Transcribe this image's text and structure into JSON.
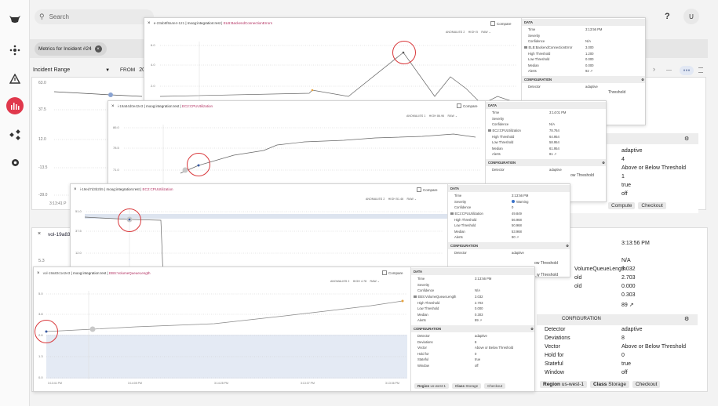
{
  "app": {
    "search_placeholder": "Search",
    "help": "?",
    "avatar": "U"
  },
  "sidebar": {
    "icons": [
      "cow-logo-icon",
      "hub-icon",
      "alert-triangle-icon",
      "analytics-icon",
      "workflow-icon",
      "gear-icon"
    ]
  },
  "chip": {
    "label": "Metrics for Incident #24"
  },
  "range": {
    "label": "Incident Range",
    "from_label": "FROM",
    "from_value": "2020,"
  },
  "rt": {
    "next": "›",
    "dashes": "—",
    "pill": "●●●"
  },
  "bgleft": {
    "yticks": [
      "37.5",
      "12.0",
      "-13.5",
      "-39.0"
    ],
    "ytop": "63.0",
    "xtime": "3:13:41 P",
    "label_5": "5.3"
  },
  "bgcard_a": {
    "detector": "adaptive",
    "deviations": "4",
    "vector": "Above or Below Threshold",
    "hold_for": "1",
    "stateful": "true",
    "window": "off",
    "btn_compute": "Compute",
    "btn_checkout": "Checkout"
  },
  "bgcard_b": {
    "title": "vol-19a83",
    "x": "×",
    "time": "3:13:56 PM",
    "confidence": "N/A",
    "metric_name": "VolumeQueueLength",
    "metric": "3.032",
    "high": "2.703",
    "low": "0.000",
    "median": "0.303",
    "alerts": "89 ↗",
    "alerts_link": "↗",
    "config": "CONFIGURATION",
    "detector_k": "Detector",
    "detector": "adaptive",
    "deviations_k": "Deviations",
    "deviations": "8",
    "vector_k": "Vector",
    "vector": "Above or Below Threshold",
    "hold_k": "Hold for",
    "hold": "0",
    "stateful_k": "Stateful",
    "stateful": "true",
    "window_k": "Window",
    "window": "off",
    "region": "Region",
    "region_v": "us-west-1",
    "class": "Class",
    "class_v": "Storage",
    "checkout": "Checkout",
    "hold_frag": "old",
    "old_frag": "old"
  },
  "p1": {
    "title": "e-23ab8f8a4e4-121",
    "src": "moog:integration:rest",
    "metric": "ELB:BackendConnectionErrors",
    "compare": "Compare",
    "anomalies": "ANOMALIES 2",
    "high": "HIGH 5",
    "raw": "RAW",
    "yticks": [
      "6.0",
      "4.0",
      "2.0"
    ],
    "data": {
      "Time": "3:13:56 PM",
      "Severity": "",
      "Confidence": "N/A",
      "ELB:BackendConnectionError": "3.000",
      "High Threshold": "1.200",
      "Low Threshold": "0.000",
      "Median": "0.000",
      "Alerts": "92 ↗"
    },
    "detector": "adaptive",
    "t_ov": "Threshold"
  },
  "p2": {
    "title": "i-19a84d0e42e3",
    "src": "moog:integration:rest",
    "metric": "EC2:CPUUtilization",
    "compare": "Compare",
    "anomalies": "ANOMALIES 1",
    "high": "HIGH 86.96",
    "raw": "RAW",
    "yticks": [
      "86.0",
      "78.5",
      "71.0"
    ],
    "data": {
      "Time": "3:14:01 PM",
      "Severity": "",
      "Confidence": "N/A",
      "EC2:CPUUtilization": "78.764",
      "High Threshold": "64.954",
      "Low Threshold": "58.954",
      "Median": "61.954",
      "Alerts": "81 ↗"
    },
    "detector": "adaptive",
    "t_ov": "ow Threshold",
    "ut": "ut"
  },
  "p3": {
    "title": "i-19ed7d3b2b5",
    "src": "moog:integration:rest",
    "metric": "EC2:CPUUtilization",
    "compare": "Compare",
    "anomalies": "ANOMALIES 2",
    "high": "HIGH 51.46",
    "raw": "RAW",
    "yticks": [
      "51.0",
      "37.5",
      "12.0"
    ],
    "data": {
      "Time": "3:13:56 PM",
      "Severity": "Warning",
      "Confidence": "0",
      "EC2:CPUUtilization": "49.849",
      "High Threshold": "56.968",
      "Low Threshold": "50.968",
      "Median": "53.968",
      "Alerts": "90 ↗"
    },
    "detector": "adaptive",
    "t_ov": "ow Threshold",
    "ut": "out"
  },
  "p4": {
    "title": "vol-19a83c1e2e3",
    "src": "moog:integration:rest",
    "metric": "EBS:VolumeQueueLength",
    "compare": "Compare",
    "anomalies": "ANOMALIES 2",
    "high": "HIGH 4.78",
    "raw": "RAW",
    "yticks": [
      "5.0",
      "3.8",
      "2.6",
      "1.3",
      "0.0"
    ],
    "xticks": [
      "3:13:41 PM",
      "3:14:05 PM",
      "3:14:28 PM",
      "3:13:37 PM",
      "3:13:36 PM"
    ],
    "data": {
      "Time": "3:13:56 PM",
      "Severity": "",
      "Confidence": "N/A",
      "EBS:VolumeQueueLength": "3.032",
      "High Threshold": "2.703",
      "Low Threshold": "0.000",
      "Median": "0.303",
      "Alerts": "89 ↗"
    },
    "config": {
      "Detector": "adaptive",
      "Deviations": "8",
      "Vector": "Above or Below Threshold",
      "Hold for": "0",
      "Stateful": "true",
      "Window": "off"
    },
    "region": "Region",
    "region_v": "us-west-1",
    "class": "Class",
    "class_v": "Storage",
    "checkout": "Checkout",
    "t_ov": "w Threshold"
  },
  "labels": {
    "data": "DATA",
    "configuration": "CONFIGURATION",
    "detector": "Detector",
    "x": "×",
    "gear": "⚙",
    "caret": "⌄"
  }
}
